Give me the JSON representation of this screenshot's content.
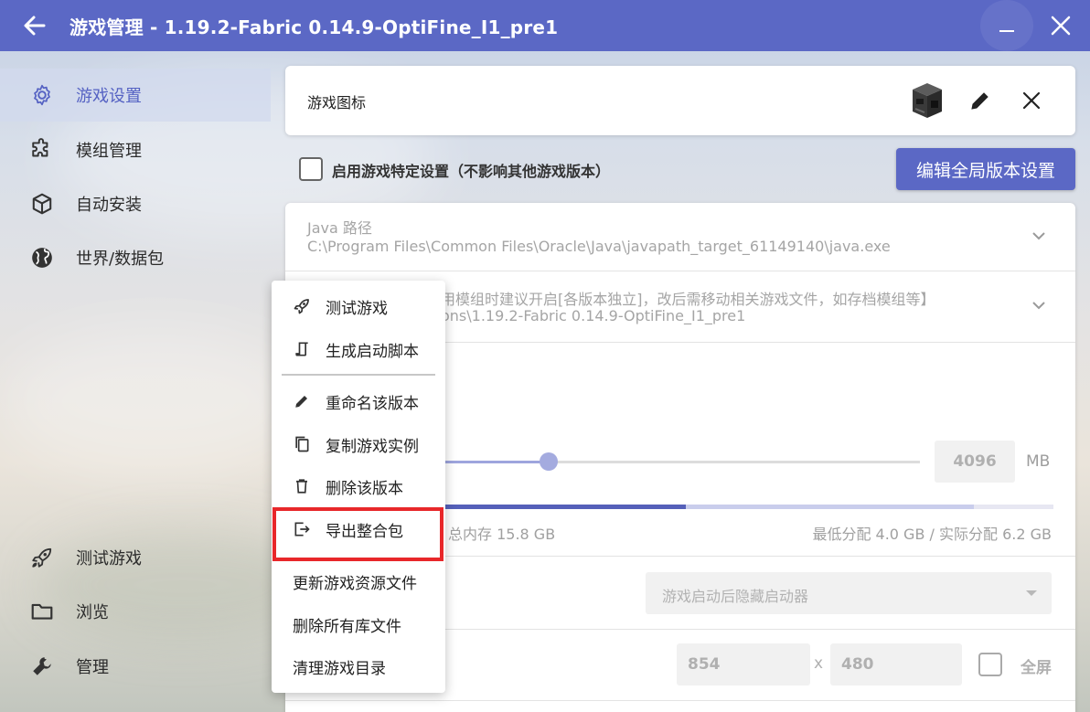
{
  "titlebar": {
    "title": "游戏管理 - 1.19.2-Fabric 0.14.9-OptiFine_I1_pre1",
    "accent": "#5b68c5"
  },
  "sidebar": {
    "top_items": [
      {
        "label": "游戏设置",
        "icon": "gear-icon",
        "active": true
      },
      {
        "label": "模组管理",
        "icon": "puzzle-icon"
      },
      {
        "label": "自动安装",
        "icon": "cube-icon"
      },
      {
        "label": "世界/数据包",
        "icon": "globe-icon"
      }
    ],
    "bottom_items": [
      {
        "label": "测试游戏",
        "icon": "rocket-icon"
      },
      {
        "label": "浏览",
        "icon": "folder-icon"
      },
      {
        "label": "管理",
        "icon": "wrench-icon"
      }
    ]
  },
  "game_icon": {
    "label": "游戏图标"
  },
  "specific_settings": {
    "label": "启用游戏特定设置（不影响其他游戏版本）",
    "global_button": "编辑全局版本设置"
  },
  "java": {
    "title": "Java 路径",
    "path": "C:\\Program Files\\Common Files\\Oracle\\Java\\javapath_target_61149140\\java.exe"
  },
  "game_dir": {
    "line1": "用模组时建议开启[各版本独立]，改后需移动相关游戏文件，如存档模组等】",
    "line2": "ons\\1.19.2-Fabric 0.14.9-OptiFine_I1_pre1"
  },
  "memory": {
    "value": "4096",
    "unit": "MB",
    "total": "总内存 15.8 GB",
    "allocation": "最低分配 4.0 GB / 实际分配 6.2 GB",
    "used_fraction": 0.4,
    "alloc_fraction": 0.87
  },
  "launcher_visibility": {
    "selected": "游戏启动后隐藏启动器"
  },
  "resolution": {
    "width": "854",
    "separator": "x",
    "height": "480",
    "fullscreen_label": "全屏"
  },
  "context_menu": {
    "items_top": [
      {
        "label": "测试游戏",
        "icon": "rocket-icon"
      },
      {
        "label": "生成启动脚本",
        "icon": "script-icon"
      }
    ],
    "items_bottom": [
      {
        "label": "重命名该版本",
        "icon": "pencil-icon"
      },
      {
        "label": "复制游戏实例",
        "icon": "copy-icon"
      },
      {
        "label": "删除该版本",
        "icon": "trash-icon"
      },
      {
        "label": "导出整合包",
        "icon": "export-icon",
        "highlighted": true
      },
      {
        "label": "更新游戏资源文件"
      },
      {
        "label": "删除所有库文件"
      },
      {
        "label": "清理游戏目录"
      }
    ],
    "highlight_color": "#e8272a"
  }
}
